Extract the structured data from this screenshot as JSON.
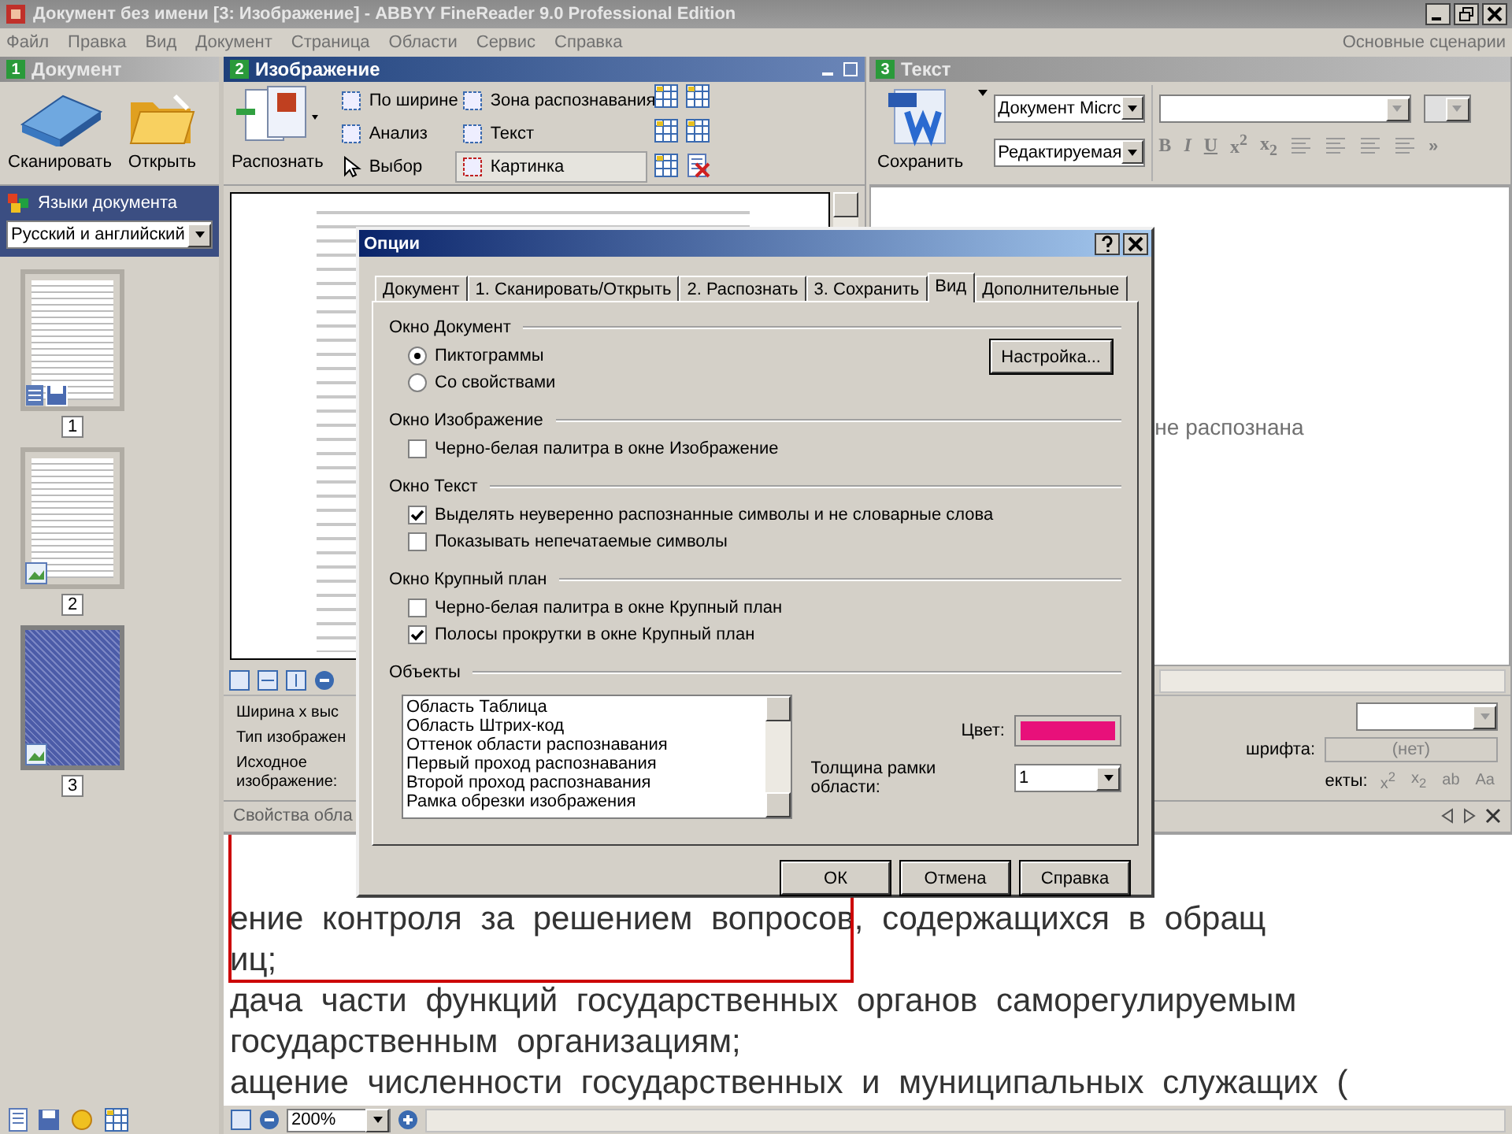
{
  "window": {
    "title": "Документ без имени [3: Изображение] - ABBYY FineReader 9.0 Professional Edition"
  },
  "menu": [
    "Файл",
    "Правка",
    "Вид",
    "Документ",
    "Страница",
    "Области",
    "Сервис",
    "Справка"
  ],
  "scenarios": "Основные сценарии",
  "document_panel": {
    "number": "1",
    "title": "Документ",
    "buttons": [
      "Сканировать",
      "Открыть"
    ],
    "languages_label": "Языки документа",
    "language": "Русский и английский",
    "pages": [
      {
        "number": "1",
        "selected": false,
        "kind": "text"
      },
      {
        "number": "2",
        "selected": false,
        "kind": "picture"
      },
      {
        "number": "3",
        "selected": true,
        "kind": "picture"
      }
    ]
  },
  "image_panel": {
    "number": "2",
    "title": "Изображение",
    "recognize": "Распознать",
    "tools": [
      {
        "label": "По ширине",
        "selected": false
      },
      {
        "label": "Зона распознавания",
        "selected": false
      },
      {
        "label": "Анализ",
        "selected": false
      },
      {
        "label": "Текст",
        "selected": false
      },
      {
        "label": "Выбор",
        "selected": false
      },
      {
        "label": "Картинка",
        "selected": true
      }
    ],
    "properties": [
      "Ширина х выс",
      "Тип изображен",
      "Исходное изображение:"
    ],
    "properties_tab": "Свойства обла"
  },
  "text_panel": {
    "number": "3",
    "title": "Текст",
    "save": "Сохранить",
    "format": "Документ Micrc",
    "mode": "Редактируемая",
    "more": "»",
    "format_buttons": [
      "B",
      "I",
      "U",
      "x$^{2}$",
      "x$_{2}$"
    ],
    "message": "не распознана",
    "font_label": "шрифта:",
    "font_value": "(нет)",
    "effects_label": "екты:",
    "effects_buttons": [
      "x$^{2}$",
      "x$_{2}$",
      "ab",
      "Aa"
    ]
  },
  "zoom_panel": {
    "lines": [
      "ение контроля за решением вопросов, содержащихся в обращ",
      "иц;",
      "дача части функций государственных органов саморегулируемым",
      "государственным организациям;",
      "ащение численности государственных и муниципальных служащих ("
    ],
    "zoom": "200%"
  },
  "dialog": {
    "title": "Опции",
    "tabs": [
      {
        "label": "Документ",
        "selected": false
      },
      {
        "label": "1. Сканировать/Открыть",
        "selected": false
      },
      {
        "label": "2. Распознать",
        "selected": false
      },
      {
        "label": "3. Сохранить",
        "selected": false
      },
      {
        "label": "Вид",
        "selected": true
      },
      {
        "label": "Дополнительные",
        "selected": false
      }
    ],
    "sections": [
      {
        "title": "Окно Документ",
        "button": "Настройка...",
        "items": [
          {
            "kind": "radio",
            "label": "Пиктограммы",
            "selected": true
          },
          {
            "kind": "radio",
            "label": "Со свойствами",
            "selected": false
          }
        ]
      },
      {
        "title": "Окно Изображение",
        "items": [
          {
            "kind": "checkbox",
            "label": "Черно-белая палитра в окне Изображение",
            "checked": false
          }
        ]
      },
      {
        "title": "Окно Текст",
        "items": [
          {
            "kind": "checkbox",
            "label": "Выделять неуверенно распознанные символы и не словарные слова",
            "checked": true
          },
          {
            "kind": "checkbox",
            "label": "Показывать непечатаемые символы",
            "checked": false
          }
        ]
      },
      {
        "title": "Окно Крупный план",
        "items": [
          {
            "kind": "checkbox",
            "label": "Черно-белая палитра в окне Крупный план",
            "checked": false
          },
          {
            "kind": "checkbox",
            "label": "Полосы прокрутки в окне Крупный план",
            "checked": true
          }
        ]
      }
    ],
    "objects": {
      "title": "Объекты",
      "items": [
        "Область Таблица",
        "Область Штрих-код",
        "Оттенок области распознавания",
        "Первый проход распознавания",
        "Второй проход распознавания",
        "Рамка обрезки изображения"
      ],
      "color_label": "Цвет:",
      "color": "#e8107a",
      "thickness_label": "Толщина рамки области:",
      "thickness": "1"
    },
    "buttons": [
      "ОК",
      "Отмена",
      "Справка"
    ]
  }
}
